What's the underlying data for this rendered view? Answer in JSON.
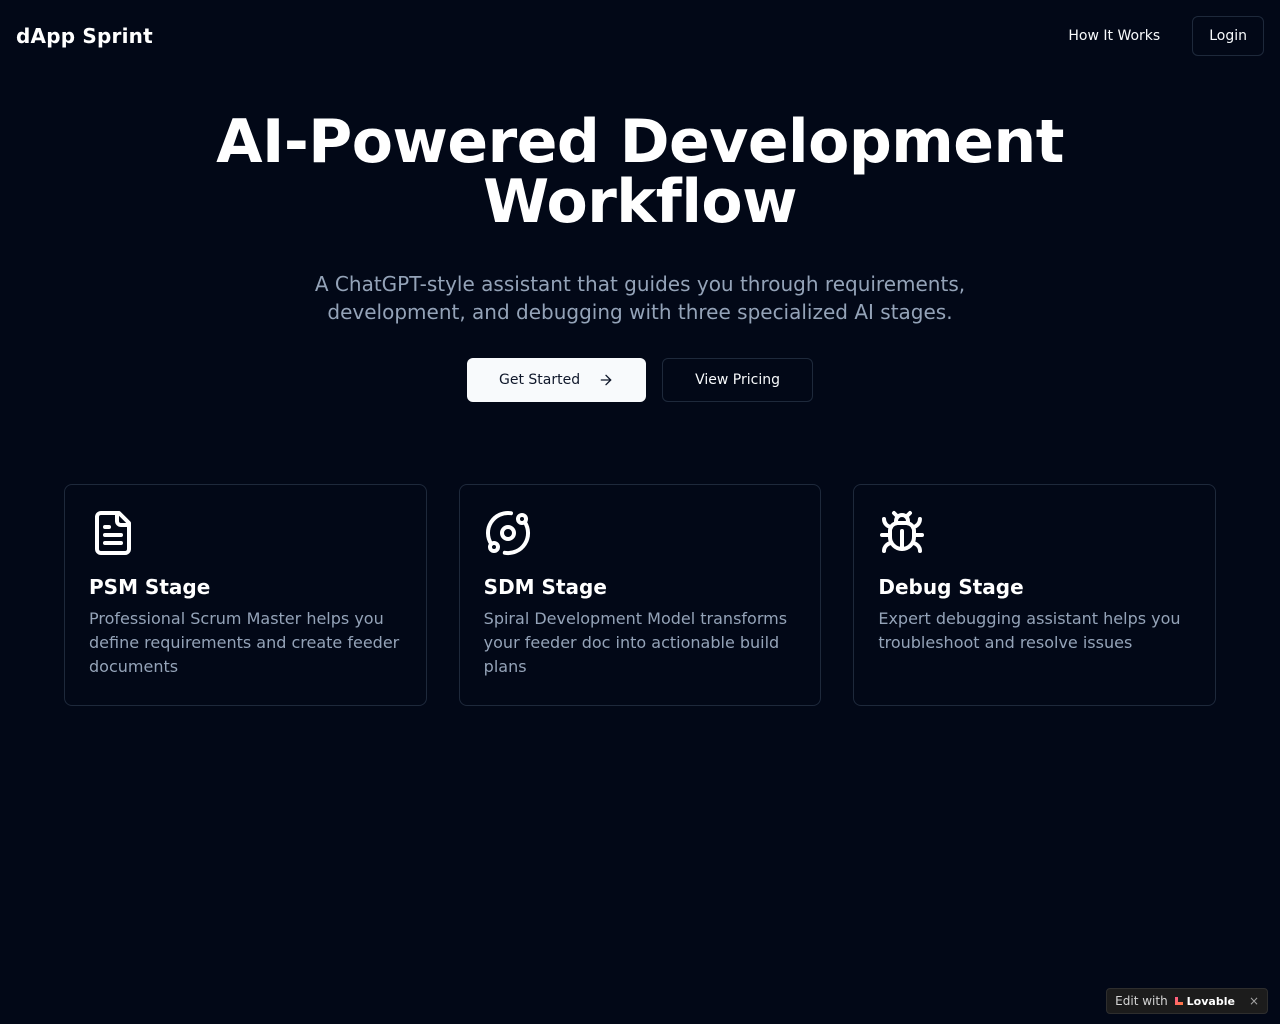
{
  "header": {
    "brand": "dApp Sprint",
    "nav_how": "How It Works",
    "login": "Login"
  },
  "hero": {
    "title": "AI-Powered Development Workflow",
    "subtitle": "A ChatGPT-style assistant that guides you through requirements, development, and debugging with three specialized AI stages.",
    "cta_primary": "Get Started",
    "cta_secondary": "View Pricing"
  },
  "cards": [
    {
      "icon": "document-icon",
      "title": "PSM Stage",
      "description": "Professional Scrum Master helps you define requirements and create feeder documents"
    },
    {
      "icon": "orbit-icon",
      "title": "SDM Stage",
      "description": "Spiral Development Model transforms your feeder doc into actionable build plans"
    },
    {
      "icon": "bug-icon",
      "title": "Debug Stage",
      "description": "Expert debugging assistant helps you troubleshoot and resolve issues"
    }
  ],
  "badge": {
    "prefix": "Edit with",
    "brand": "Lovable",
    "close": "×"
  },
  "colors": {
    "background": "#020817",
    "muted_text": "#94a3b8",
    "border": "#1e293b",
    "primary_button": "#f8fafc"
  }
}
